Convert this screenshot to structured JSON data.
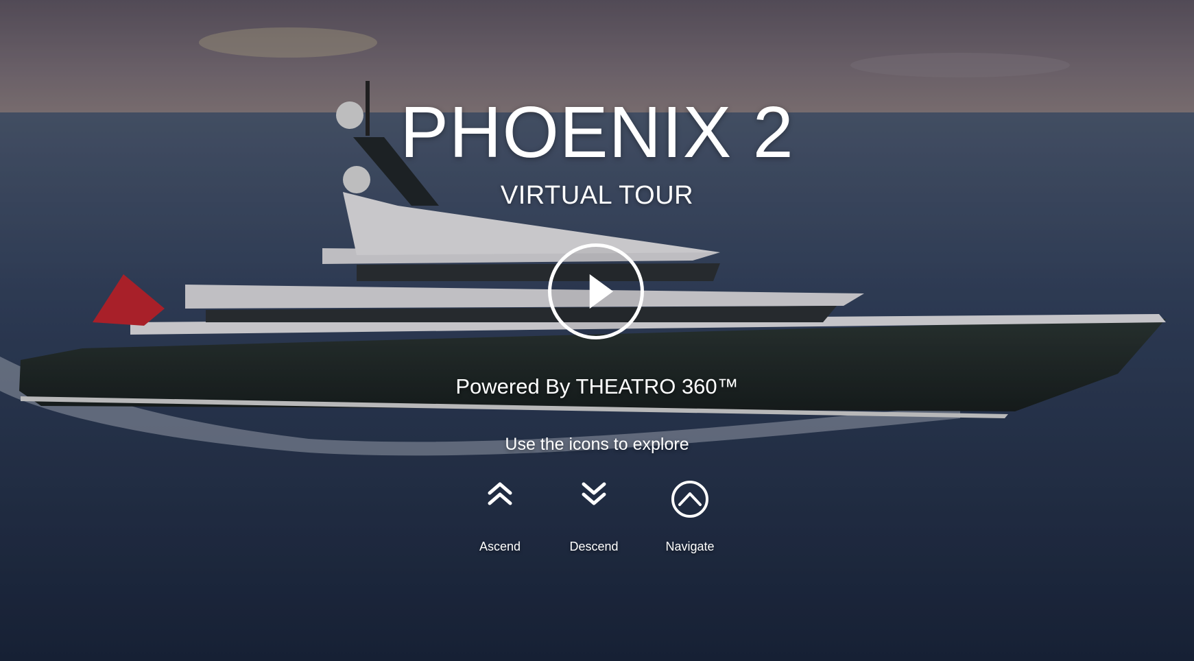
{
  "tour": {
    "title": "PHOENIX 2",
    "subtitle": "VIRTUAL TOUR",
    "powered_by": "Powered By THEATRO 360™",
    "instructions": "Use the icons to explore"
  },
  "play_button": {
    "icon": "play-icon"
  },
  "nav": [
    {
      "label": "Ascend",
      "icon": "double-chevron-up-icon"
    },
    {
      "label": "Descend",
      "icon": "double-chevron-down-icon"
    },
    {
      "label": "Navigate",
      "icon": "chevron-up-circle-icon"
    }
  ],
  "colors": {
    "text": "#ffffff",
    "sky": "#6f6470",
    "sea": "#1f3050",
    "hull": "#1f2a28",
    "superstructure": "#e9e7ea",
    "flag": "#c8232c"
  }
}
